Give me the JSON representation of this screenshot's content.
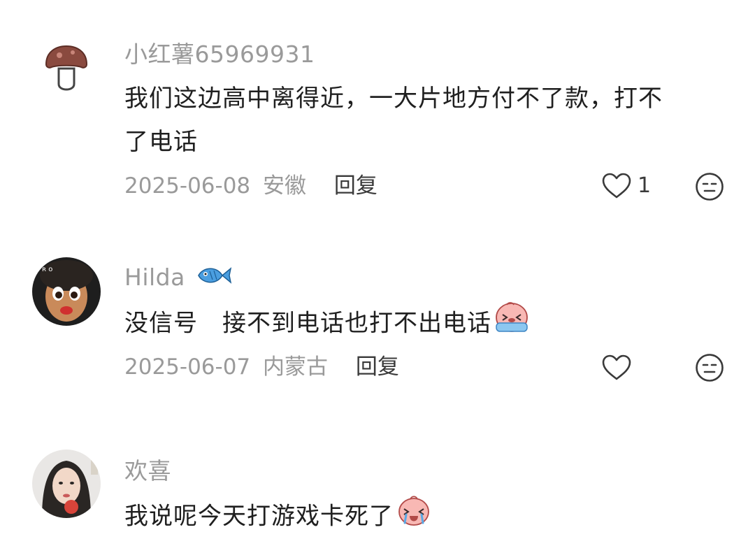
{
  "comments": [
    {
      "username": "小红薯65969931",
      "text_line1": "我们这边高中离得近，一大片地方付不了款，打不",
      "text_line2": "了电话",
      "date": "2025-06-08",
      "location": "安徽",
      "reply_label": "回复",
      "like_count": "1",
      "avatar_icon": "mushroom-icon"
    },
    {
      "username": "Hilda",
      "username_badge_icon": "fish-icon",
      "text": "没信号　接不到电话也打不出电话",
      "text_emoji_icon": "crying-emoji-icon",
      "date": "2025-06-07",
      "location": "内蒙古",
      "reply_label": "回复",
      "like_count": ""
    },
    {
      "username": "欢喜",
      "text": "我说呢今天打游戏卡死了",
      "text_emoji_icon": "crying-emoji-icon"
    }
  ],
  "colors": {
    "meta_gray": "#9a9a9a",
    "text_dark": "#1f1f1f",
    "icon_dark": "#3a3a3a",
    "fish_blue": "#3d8fd6",
    "emoji_pink": "#f6a5a5"
  }
}
